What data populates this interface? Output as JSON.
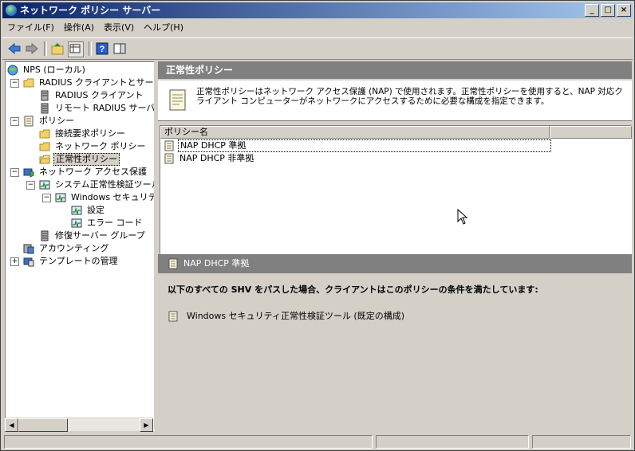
{
  "window": {
    "title": "ネットワーク ポリシー サーバー"
  },
  "title_buttons": {
    "minimize": "_",
    "maximize": "□",
    "close": "×"
  },
  "menu": [
    "ファイル(F)",
    "操作(A)",
    "表示(V)",
    "ヘルプ(H)"
  ],
  "toolbar": {
    "icons": [
      "back-arrow-icon",
      "forward-arrow-icon",
      "up-folder-icon",
      "show-hide-tree-icon",
      "help-icon",
      "action-pane-icon"
    ]
  },
  "tree": {
    "root": "NPS (ローカル)",
    "radius": "RADIUS クライアントとサーバー",
    "radius_clients": "RADIUS クライアント",
    "remote_radius": "リモート RADIUS サーバー",
    "policies": "ポリシー",
    "connection_request": "接続要求ポリシー",
    "network_policy": "ネットワーク ポリシー",
    "health_policy": "正常性ポリシー",
    "nap": "ネットワーク アクセス保護",
    "shv": "システム正常性検証ツール",
    "windows_shv": "Windows セキュリティ正",
    "settings": "設定",
    "error_codes": "エラー コード",
    "remediation": "修復サーバー グループ",
    "accounting": "アカウンティング",
    "templates": "テンプレートの管理"
  },
  "header": {
    "title": "正常性ポリシー"
  },
  "description": "正常性ポリシーはネットワーク アクセス保護 (NAP) で使用されます。正常性ポリシーを使用すると、NAP 対応クライアント コンピューターがネットワークにアクセスするために必要な構成を指定できます。",
  "list": {
    "columns": [
      "ポリシー名",
      ""
    ],
    "rows": [
      "NAP DHCP 準拠",
      "NAP DHCP 非準拠"
    ]
  },
  "detail": {
    "title": "NAP DHCP 準拠",
    "lead": "以下のすべての SHV をパスした場合、クライアントはこのポリシーの条件を満たしています:",
    "item": "Windows セキュリティ正常性検証ツール (既定の構成)"
  },
  "scroll": {
    "left": "◀",
    "right": "▶"
  },
  "colors": {
    "title_start": "#0a246a",
    "title_end": "#a6caf0",
    "pane_header": "#808080"
  }
}
